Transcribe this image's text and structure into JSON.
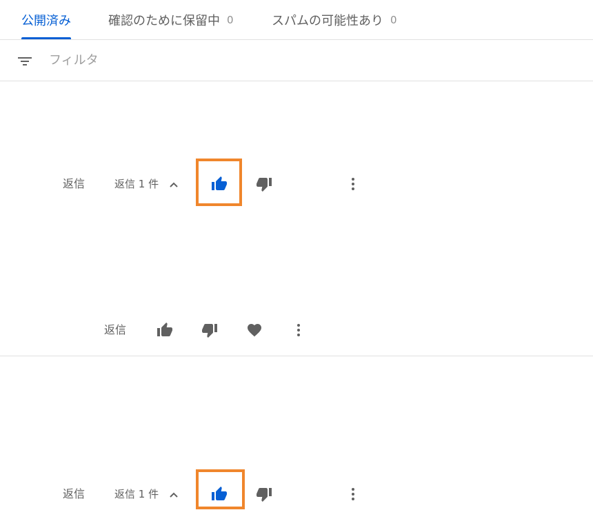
{
  "tabs": [
    {
      "label": "公開済み",
      "count": ""
    },
    {
      "label": "確認のために保留中",
      "count": "0"
    },
    {
      "label": "スパムの可能性あり",
      "count": "0"
    }
  ],
  "filter": {
    "placeholder": "フィルタ"
  },
  "comments": [
    {
      "reply_label": "返信",
      "replies_label": "返信 1 件"
    },
    {
      "reply_label": "返信"
    },
    {
      "reply_label": "返信",
      "replies_label": "返信 1 件"
    }
  ],
  "colors": {
    "accent": "#065fd4",
    "highlight": "#f0862c",
    "icon": "#606060"
  }
}
